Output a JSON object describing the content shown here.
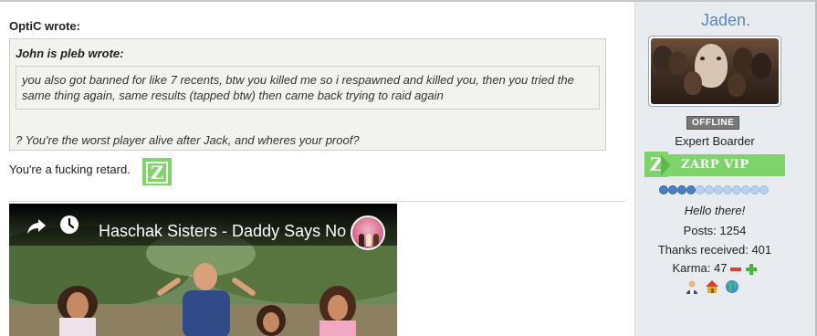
{
  "post": {
    "outer_quote_author": "OptiC wrote:",
    "inner_quote": {
      "author": "John is pleb wrote:",
      "text": "you also got banned for like 7 recents, btw you killed me so i respawned and killed you, then you tried the same thing again, same results (tapped btw) then came back trying to raid again"
    },
    "outer_quote_reply": "? You're the worst player alive after Jack, and wheres your proof?",
    "body_text": "You're a fucking retard.",
    "emoji_letter": "Z",
    "video": {
      "title": "Haschak Sisters - Daddy Says No"
    }
  },
  "sidebar": {
    "username": "Jaden.",
    "status": "OFFLINE",
    "user_title": "Expert Boarder",
    "vip": {
      "letter": "Z",
      "label": "ZARP VIP"
    },
    "reputation": {
      "filled": 4,
      "total": 12
    },
    "motto": "Hello there!",
    "posts": "Posts: 1254",
    "thanks": "Thanks received: 401",
    "karma": "Karma: 47",
    "icons": [
      "user-icon",
      "home-icon",
      "globe-icon"
    ]
  },
  "colors": {
    "username": "#5a86b5",
    "vip_green": "#7ed36a",
    "sidebar_bg": "#e8ecf1",
    "quote_bg": "#f2f2ee"
  }
}
